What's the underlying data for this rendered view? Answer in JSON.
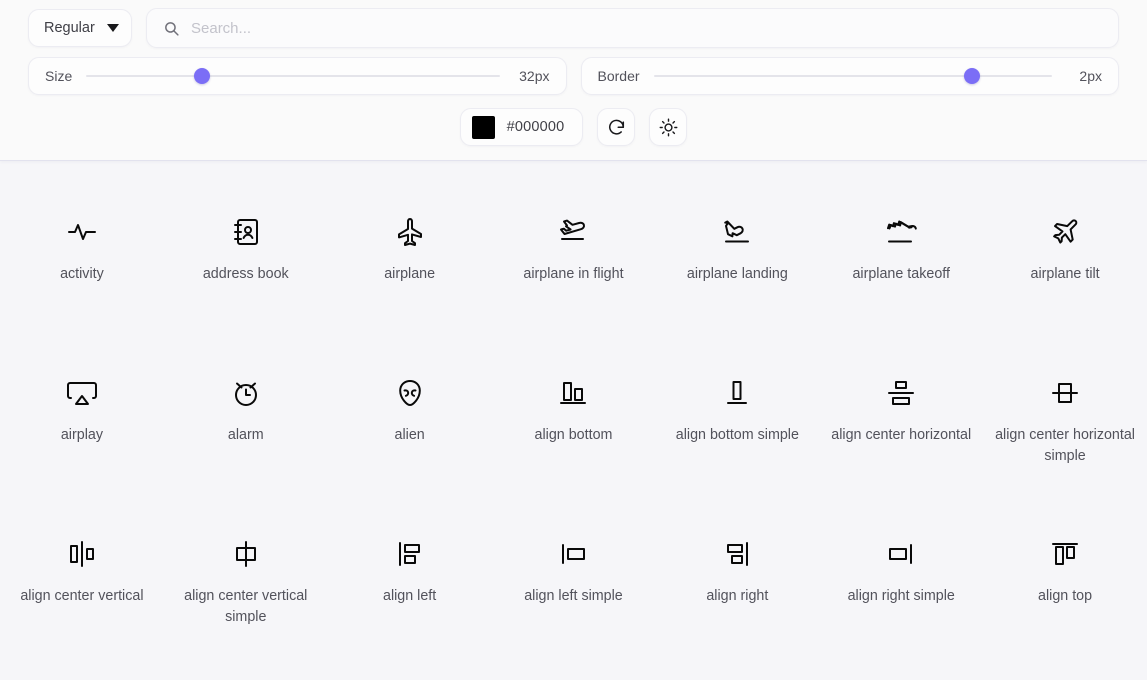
{
  "toolbar": {
    "weight_select": {
      "value": "Regular",
      "icon": "chevron-down-icon"
    },
    "search": {
      "value": "",
      "placeholder": "Search...",
      "icon": "search-icon"
    },
    "size_slider": {
      "label": "Size",
      "value_text": "32px",
      "value": 32,
      "min": 8,
      "max": 96,
      "percent": 28
    },
    "border_slider": {
      "label": "Border",
      "value_text": "2px",
      "value": 2,
      "min": 1,
      "max": 4,
      "percent": 80
    },
    "color": {
      "hex": "#000000",
      "swatch_color": "#000000"
    },
    "reset_button": {
      "icon": "refresh-icon",
      "label": ""
    },
    "theme_button": {
      "icon": "sun-icon",
      "label": ""
    },
    "accent_color": "#7b6ef6"
  },
  "grid": {
    "icons": [
      {
        "name": "activity",
        "label": "activity"
      },
      {
        "name": "address-book",
        "label": "address book"
      },
      {
        "name": "airplane",
        "label": "airplane"
      },
      {
        "name": "airplane-in-flight",
        "label": "airplane in flight"
      },
      {
        "name": "airplane-landing",
        "label": "airplane landing"
      },
      {
        "name": "airplane-takeoff",
        "label": "airplane takeoff"
      },
      {
        "name": "airplane-tilt",
        "label": "airplane tilt"
      },
      {
        "name": "airplay",
        "label": "airplay"
      },
      {
        "name": "alarm",
        "label": "alarm"
      },
      {
        "name": "alien",
        "label": "alien"
      },
      {
        "name": "align-bottom",
        "label": "align bottom"
      },
      {
        "name": "align-bottom-simple",
        "label": "align bottom simple"
      },
      {
        "name": "align-center-horizontal",
        "label": "align center horizontal"
      },
      {
        "name": "align-center-horizontal-simple",
        "label": "align center horizontal simple"
      },
      {
        "name": "align-center-vertical",
        "label": "align center vertical"
      },
      {
        "name": "align-center-vertical-simple",
        "label": "align center vertical simple"
      },
      {
        "name": "align-left",
        "label": "align left"
      },
      {
        "name": "align-left-simple",
        "label": "align left simple"
      },
      {
        "name": "align-right",
        "label": "align right"
      },
      {
        "name": "align-right-simple",
        "label": "align right simple"
      },
      {
        "name": "align-top",
        "label": "align top"
      }
    ]
  }
}
